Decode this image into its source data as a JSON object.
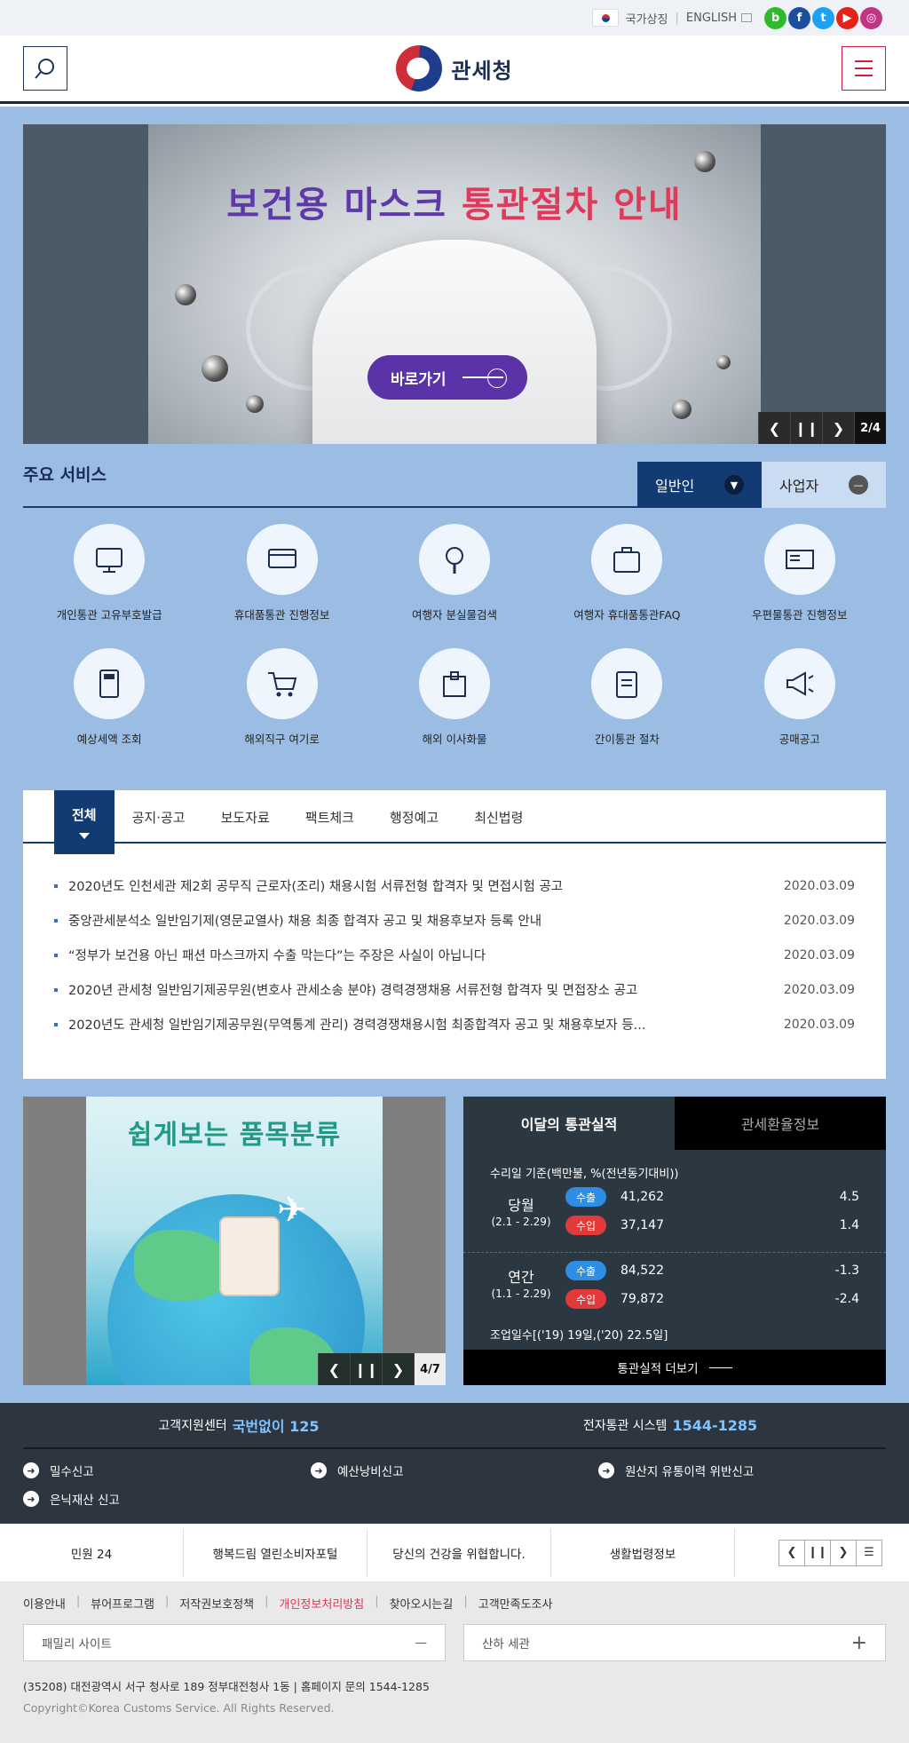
{
  "util": {
    "symbol_label": "국가상징",
    "english_label": "ENGLISH",
    "sns": [
      {
        "icon": "blog-icon",
        "glyph": "b",
        "color": "#2dbb2d"
      },
      {
        "icon": "facebook-icon",
        "glyph": "f",
        "color": "#1d4fa0"
      },
      {
        "icon": "twitter-icon",
        "glyph": "t",
        "color": "#1da1f2"
      },
      {
        "icon": "youtube-icon",
        "glyph": "▶",
        "color": "#e62117"
      },
      {
        "icon": "instagram-icon",
        "glyph": "◎",
        "color": "#c13584"
      }
    ]
  },
  "header": {
    "logo_text": "관세청",
    "search_icon": "search-icon",
    "menu_icon": "hamburger-menu-icon"
  },
  "hero": {
    "title_part1": "보건용 마스크",
    "title_part2": "통관절차 안내",
    "go_label": "바로가기",
    "counter": "2/4"
  },
  "services": {
    "title": "주요 서비스",
    "tab_general": "일반인",
    "tab_business": "사업자",
    "items": [
      {
        "label": "개인통관 고유부호발급",
        "icon": "computer-pen-icon"
      },
      {
        "label": "휴대품통관 진행정보",
        "icon": "card-hand-icon"
      },
      {
        "label": "여행자 분실물검색",
        "icon": "magnifier-icon"
      },
      {
        "label": "여행자 휴대품통관FAQ",
        "icon": "suitcase-icon"
      },
      {
        "label": "우편물통관 진행정보",
        "icon": "mail-icon"
      },
      {
        "label": "예상세액 조회",
        "icon": "calculator-icon"
      },
      {
        "label": "해외직구 여기로",
        "icon": "shopping-cart-icon"
      },
      {
        "label": "해외 이사화물",
        "icon": "box-icon"
      },
      {
        "label": "간이통관 절차",
        "icon": "clipboard-icon"
      },
      {
        "label": "공매공고",
        "icon": "megaphone-icon"
      }
    ]
  },
  "notice": {
    "tabs": [
      "전체",
      "공지·공고",
      "보도자료",
      "팩트체크",
      "행정예고",
      "최신법령"
    ],
    "rows": [
      {
        "title": "2020년도 인천세관 제2회 공무직 근로자(조리) 채용시험 서류전형 합격자 및 면접시험 공고",
        "date": "2020.03.09"
      },
      {
        "title": "중앙관세분석소 일반임기제(영문교열사) 채용 최종 합격자 공고 및 채용후보자 등록 안내",
        "date": "2020.03.09"
      },
      {
        "title": "“정부가 보건용 아닌 패션 마스크까지 수출 막는다”는 주장은 사실이 아닙니다",
        "date": "2020.03.09"
      },
      {
        "title": "2020년 관세청 일반임기제공무원(변호사 관세소송 분야) 경력경쟁채용 서류전형 합격자 및 면접장소 공고",
        "date": "2020.03.09"
      },
      {
        "title": "2020년도 관세청 일반임기제공무원(무역통계 관리) 경력경쟁채용시험 최종합격자 공고 및 채용후보자 등...",
        "date": "2020.03.09"
      }
    ]
  },
  "banner2": {
    "title": "쉽게보는 품목분류",
    "counter": "4/7"
  },
  "stats": {
    "tab_on": "이달의 통관실적",
    "tab_off": "관세환율정보",
    "basis": "수리일 기준(백만불, %(전년동기대비))",
    "monthly": {
      "label": "당월",
      "range": "(2.1 - 2.29)",
      "export_label": "수출",
      "export_value": "41,262",
      "export_rate": "4.5",
      "import_label": "수입",
      "import_value": "37,147",
      "import_rate": "1.4"
    },
    "annual": {
      "label": "연간",
      "range": "(1.1 - 2.29)",
      "export_label": "수출",
      "export_value": "84,522",
      "export_rate": "-1.3",
      "import_label": "수입",
      "import_value": "79,872",
      "import_rate": "-2.4"
    },
    "days": "조업일수[('19) 19일,('20) 22.5일]",
    "more": "통관실적 더보기"
  },
  "footer": {
    "center_label": "고객지원센터",
    "center_num": "국번없이 125",
    "edi_label": "전자통관 시스템",
    "edi_num": "1544-1285",
    "links": [
      "밀수신고",
      "예산낭비신고",
      "원산지 유통이력 위반신고",
      "은닉재산 신고"
    ],
    "related": [
      "민원 24",
      "행복드림 열린소비자포털",
      "당신의 건강을 위협합니다.",
      "생활법령정보"
    ],
    "policy": [
      "이용안내",
      "뷰어프로그램",
      "저작권보호정책",
      "개인정보처리방침",
      "찾아오시는길",
      "고객만족도조사"
    ],
    "family_site": "패밀리 사이트",
    "subsidiary": "산하 세관",
    "address": "(35208) 대전광역시 서구 청사로 189 정부대전청사 1동  |  홈페이지 문의 1544-1285",
    "copyright": "Copyright©Korea Customs Service. All Rights Reserved."
  },
  "colors": {
    "accent": "#123a73",
    "brand_red": "#cd2e3a",
    "bg_blue": "#9bbde3"
  }
}
